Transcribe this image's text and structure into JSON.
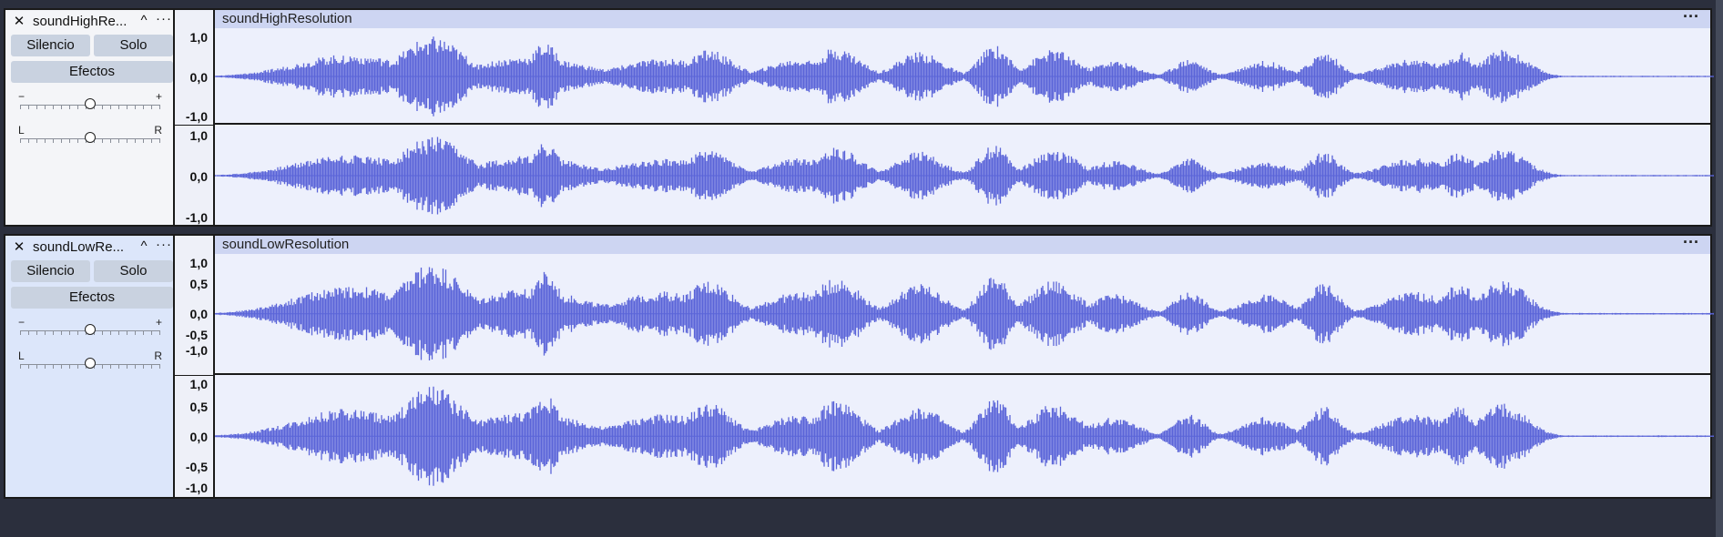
{
  "tracks": [
    {
      "name": "soundHighResolution",
      "name_short": "soundHighRe...",
      "mute_label": "Silencio",
      "solo_label": "Solo",
      "effects_label": "Efectos",
      "gain_minus": "−",
      "gain_plus": "+",
      "pan_left": "L",
      "pan_right": "R",
      "clip_title": "soundHighResolution",
      "clip_menu": "···",
      "ch1_scale": [
        "1,0",
        "0,0",
        "-1,0"
      ],
      "ch2_scale": [
        "1,0",
        "0,0",
        "-1,0"
      ]
    },
    {
      "name": "soundLowResolution",
      "name_short": "soundLowRe...",
      "mute_label": "Silencio",
      "solo_label": "Solo",
      "effects_label": "Efectos",
      "gain_minus": "−",
      "gain_plus": "+",
      "pan_left": "L",
      "pan_right": "R",
      "clip_title": "soundLowResolution",
      "clip_menu": "···",
      "ch1_scale": [
        "1,0",
        "0,5",
        "0,0",
        "-0,5",
        "-1,0"
      ],
      "ch2_scale": [
        "1,0",
        "0,5",
        "0,0",
        "-0,5",
        "-1,0"
      ]
    }
  ],
  "icons": {
    "close": "close-icon",
    "collapse": "chevron-up-icon",
    "menu": "more-icon"
  },
  "colors": {
    "waveform": "#5a64d8",
    "background": "#2b2f3d"
  }
}
